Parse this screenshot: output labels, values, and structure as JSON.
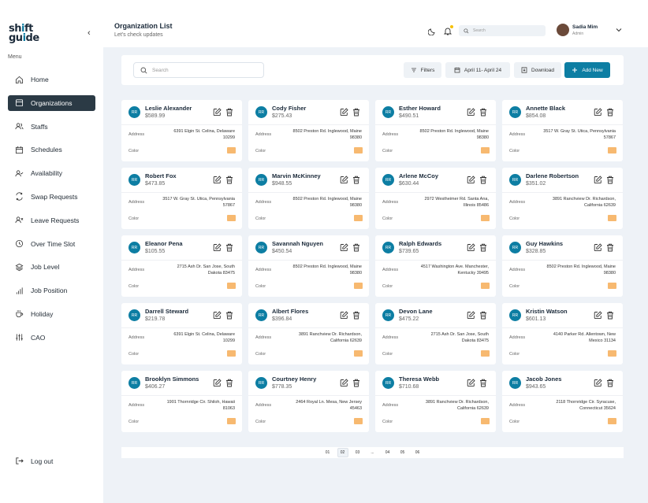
{
  "logo": {
    "line1": "sh",
    "dot": "i",
    "line1b": "ft",
    "line2": "gu",
    "dot2": "i",
    "line2b": "de"
  },
  "sidebar": {
    "menu_label": "Menu",
    "items": [
      {
        "label": "Home",
        "icon": "home-icon",
        "active": false
      },
      {
        "label": "Organizations",
        "icon": "building-icon",
        "active": true
      },
      {
        "label": "Staffs",
        "icon": "users-icon",
        "active": false
      },
      {
        "label": "Schedules",
        "icon": "calendar-icon",
        "active": false
      },
      {
        "label": "Availability",
        "icon": "user-check-icon",
        "active": false
      },
      {
        "label": "Swap Requests",
        "icon": "swap-icon",
        "active": false
      },
      {
        "label": "Leave Requests",
        "icon": "user-x-icon",
        "active": false
      },
      {
        "label": "Over Time Slot",
        "icon": "clock-icon",
        "active": false
      },
      {
        "label": "Job Level",
        "icon": "layers-icon",
        "active": false
      },
      {
        "label": "Job Position",
        "icon": "bar-chart-icon",
        "active": false
      },
      {
        "label": "Holiday",
        "icon": "coffee-icon",
        "active": false
      },
      {
        "label": "CAO",
        "icon": "sliders-icon",
        "active": false
      }
    ],
    "logout_label": "Log out"
  },
  "header": {
    "title": "Organization List",
    "subtitle": "Let's check updates",
    "search_placeholder": "Search",
    "user_name": "Sadia Mim",
    "user_role": "Admin"
  },
  "toolbar": {
    "search_placeholder": "Search",
    "filters_label": "Filters",
    "date_range": "April 11- April 24",
    "download_label": "Download",
    "add_label": "Add New"
  },
  "card_labels": {
    "address": "Address",
    "color": "Color",
    "initials": "RR"
  },
  "colors": {
    "accent": "#0d7ea3",
    "active_nav": "#2b3a45",
    "swatch": "#f7b970"
  },
  "organizations": [
    {
      "name": "Leslie Alexander",
      "price": "$589.99",
      "address": "6391 Elgin St. Celina, Delaware 10299"
    },
    {
      "name": "Cody Fisher",
      "price": "$275.43",
      "address": "8502 Preston Rd. Inglewood, Maine 98380"
    },
    {
      "name": "Esther Howard",
      "price": "$490.51",
      "address": "8502 Preston Rd. Inglewood, Maine 98380"
    },
    {
      "name": "Annette Black",
      "price": "$854.08",
      "address": "3517 W. Gray St. Utica, Pennsylvania 57867"
    },
    {
      "name": "Robert Fox",
      "price": "$473.85",
      "address": "3517 W. Gray St. Utica, Pennsylvania 57867"
    },
    {
      "name": "Marvin McKinney",
      "price": "$948.55",
      "address": "8502 Preston Rd. Inglewood, Maine 98380"
    },
    {
      "name": "Arlene McCoy",
      "price": "$630.44",
      "address": "2972 Westheimer Rd. Santa Ana, Illinois 85486"
    },
    {
      "name": "Darlene Robertson",
      "price": "$351.02",
      "address": "3891 Ranchview Dr. Richardson, California 62639"
    },
    {
      "name": "Eleanor Pena",
      "price": "$105.55",
      "address": "2715 Ash Dr. San Jose, South Dakota 83475"
    },
    {
      "name": "Savannah Nguyen",
      "price": "$450.54",
      "address": "8502 Preston Rd. Inglewood, Maine 98380"
    },
    {
      "name": "Ralph Edwards",
      "price": "$739.65",
      "address": "4517 Washington Ave. Manchester, Kentucky 39495"
    },
    {
      "name": "Guy Hawkins",
      "price": "$328.85",
      "address": "8502 Preston Rd. Inglewood, Maine 98380"
    },
    {
      "name": "Darrell Steward",
      "price": "$219.78",
      "address": "6391 Elgin St. Celina, Delaware 10299"
    },
    {
      "name": "Albert Flores",
      "price": "$396.84",
      "address": "3891 Ranchview Dr. Richardson, California 62639"
    },
    {
      "name": "Devon Lane",
      "price": "$475.22",
      "address": "2715 Ash Dr. San Jose, South Dakota 83475"
    },
    {
      "name": "Kristin Watson",
      "price": "$601.13",
      "address": "4140 Parker Rd. Allentown, New Mexico 31134"
    },
    {
      "name": "Brooklyn Simmons",
      "price": "$406.27",
      "address": "1901 Thornridge Cir. Shiloh, Hawaii 81063"
    },
    {
      "name": "Courtney Henry",
      "price": "$778.35",
      "address": "2464 Royal Ln. Mesa, New Jersey 45463"
    },
    {
      "name": "Theresa Webb",
      "price": "$710.68",
      "address": "3891 Ranchview Dr. Richardson, California 62639"
    },
    {
      "name": "Jacob Jones",
      "price": "$943.65",
      "address": "2118 Thornridge Cir. Syracuse, Connecticut 35624"
    }
  ],
  "pagination": {
    "pages": [
      "01",
      "02",
      "03",
      "...",
      "04",
      "05",
      "06"
    ],
    "current": "02"
  }
}
